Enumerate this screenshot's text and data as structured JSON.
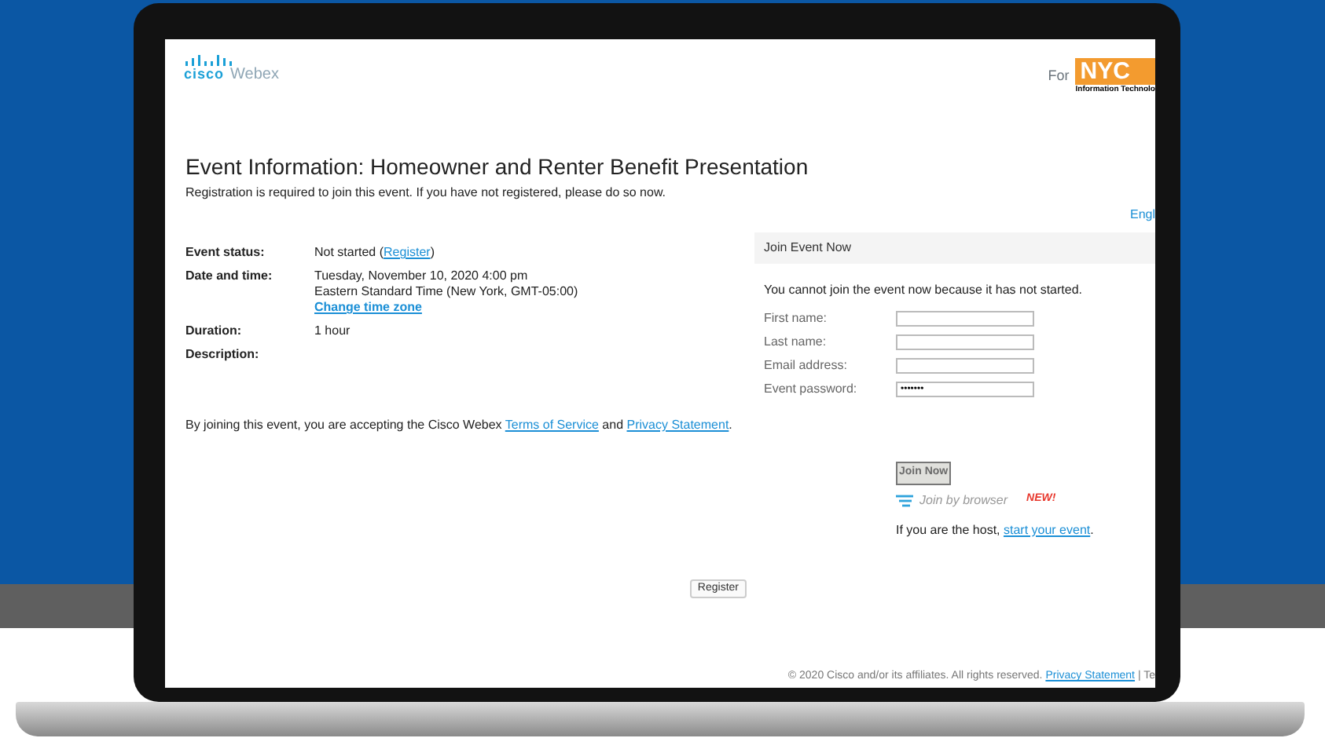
{
  "header": {
    "brand_mark": "cisco",
    "brand": "Webex",
    "for_label": "For",
    "partner_logo": "NYC",
    "partner_subtitle": "Information Technolo"
  },
  "title": "Event Information: Homeowner and Renter Benefit Presentation",
  "notice": "Registration is required to join this event. If you have not registered, please do so now.",
  "language_link": "Engl",
  "details": [
    {
      "label": "Event status:",
      "lines": [
        [
          {
            "kind": "text",
            "text": "Not started ("
          },
          {
            "kind": "link",
            "text": "Register"
          },
          {
            "kind": "text",
            "text": ")"
          }
        ]
      ]
    },
    {
      "label": "Date and time:",
      "lines": [
        [
          {
            "kind": "text",
            "text": "Tuesday, November 10, 2020 4:00 pm"
          }
        ],
        [
          {
            "kind": "text",
            "text": "Eastern Standard Time (New York, GMT-05:00)"
          }
        ],
        [
          {
            "kind": "boldlink",
            "text": "Change time zone"
          }
        ]
      ]
    },
    {
      "label": "Duration:",
      "lines": [
        [
          {
            "kind": "text",
            "text": "1 hour"
          }
        ]
      ]
    },
    {
      "label": "Description:"
    }
  ],
  "terms": [
    {
      "kind": "text",
      "text": "By joining this event, you are accepting the Cisco Webex "
    },
    {
      "kind": "link",
      "text": "Terms of Service"
    },
    {
      "kind": "text",
      "text": " and "
    },
    {
      "kind": "link",
      "text": "Privacy Statement"
    },
    {
      "kind": "text",
      "text": "."
    }
  ],
  "join_panel": {
    "heading": "Join Event Now",
    "message": "You cannot join the event now because it has not started.",
    "fields": [
      {
        "label": "First name:"
      },
      {
        "label": "Last name:"
      },
      {
        "label": "Email address:"
      },
      {
        "label": "Event password:",
        "value": "•••••••"
      }
    ],
    "join_button": {
      "label": "Join Now",
      "disabled": true
    },
    "browser_option": "Join by browser",
    "new_badge": "NEW!",
    "host_line": [
      {
        "kind": "text",
        "text": "If you are the host, "
      },
      {
        "kind": "link",
        "text": "start your event"
      },
      {
        "kind": "text",
        "text": "."
      }
    ]
  },
  "register_button": "Register",
  "footer": [
    {
      "kind": "text",
      "text": "© 2020 Cisco and/or its affiliates. All rights reserved. "
    },
    {
      "kind": "link",
      "text": "Privacy Statement"
    },
    {
      "kind": "text",
      "text": " | Te"
    }
  ]
}
